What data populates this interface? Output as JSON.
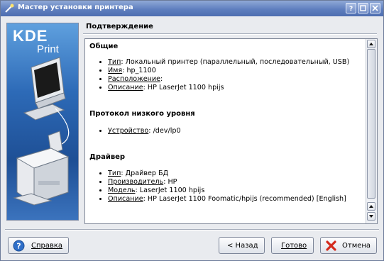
{
  "window": {
    "title": "Мастер установки принтера",
    "app_icon": "wizard-wand-icon",
    "title_buttons": [
      "help-icon",
      "minimize-icon",
      "close-icon"
    ]
  },
  "banner": {
    "logo_line1": "KDE",
    "logo_line2": "Print",
    "illustration": "computer-and-printer"
  },
  "page": {
    "section_title": "Подтверждение"
  },
  "groups": [
    {
      "heading": "Общие",
      "items": [
        {
          "label": "Тип",
          "value": ": Локальный принтер (параллельный, последовательный, USB)"
        },
        {
          "label": "Имя",
          "value": ": hp_1100"
        },
        {
          "label": "Расположение",
          "value": ":"
        },
        {
          "label": "Описание",
          "value": ": HP LaserJet 1100 hpijs"
        }
      ]
    },
    {
      "heading": "Протокол низкого уровня",
      "items": [
        {
          "label": "Устройство",
          "value": ": /dev/lp0"
        }
      ]
    },
    {
      "heading": "Драйвер",
      "items": [
        {
          "label": "Тип",
          "value": ": Драйвер БД"
        },
        {
          "label": "Производитель",
          "value": ": HP"
        },
        {
          "label": "Модель",
          "value": ": LaserJet 1100 hpijs"
        },
        {
          "label": "Описание",
          "value": ": HP LaserJet 1100 Foomatic/hpijs (recommended) [English]"
        }
      ]
    }
  ],
  "buttons": {
    "help": {
      "label": "Справка",
      "icon": "help-icon"
    },
    "back": {
      "label": "< Назад"
    },
    "finish": {
      "label": "Готово"
    },
    "cancel": {
      "label": "Отмена",
      "icon": "cancel-x-icon"
    }
  },
  "colors": {
    "titlebar": "#5f7fbf",
    "banner": "#2d6ab7",
    "cancel_icon": "#d42a1c"
  }
}
